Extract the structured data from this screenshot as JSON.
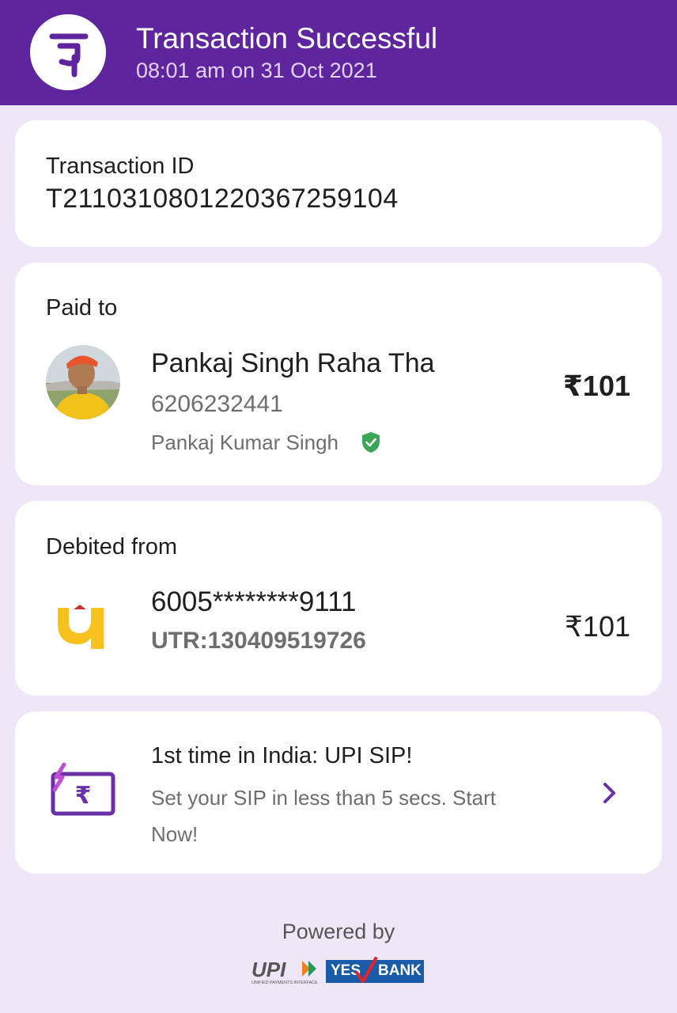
{
  "header": {
    "title": "Transaction Successful",
    "subtitle": "08:01 am on 31 Oct 2021",
    "brand_color": "#5f259f",
    "logo_icon": "phonepe-logo"
  },
  "transaction": {
    "label": "Transaction ID",
    "id": "T2110310801220367259104"
  },
  "paid_to": {
    "label": "Paid to",
    "name": "Pankaj Singh Raha Tha",
    "phone": "6206232441",
    "legal_name": "Pankaj Kumar Singh",
    "verified_icon": "verified-shield-icon",
    "amount": "₹101"
  },
  "debited_from": {
    "label": "Debited from",
    "account": "6005********9111",
    "utr": "UTR:130409519726",
    "amount": "₹101",
    "bank_icon": "pnb-bank-logo"
  },
  "promo": {
    "title": "1st time in India: UPI SIP!",
    "description": "Set your SIP in less than 5 secs. Start Now!",
    "icon": "upi-sip-icon",
    "action_icon": "chevron-right-icon"
  },
  "footer": {
    "powered_label": "Powered by",
    "logos": [
      "upi-logo",
      "yes-bank-logo"
    ],
    "upi_text": "UPI",
    "upi_subtext": "UNIFIED PAYMENTS INTERFACE",
    "yes_text_1": "YES",
    "yes_text_2": "BANK"
  },
  "colors": {
    "background": "#efe6f8",
    "verified_green": "#3aa757",
    "bank_yellow": "#f7c21e"
  }
}
